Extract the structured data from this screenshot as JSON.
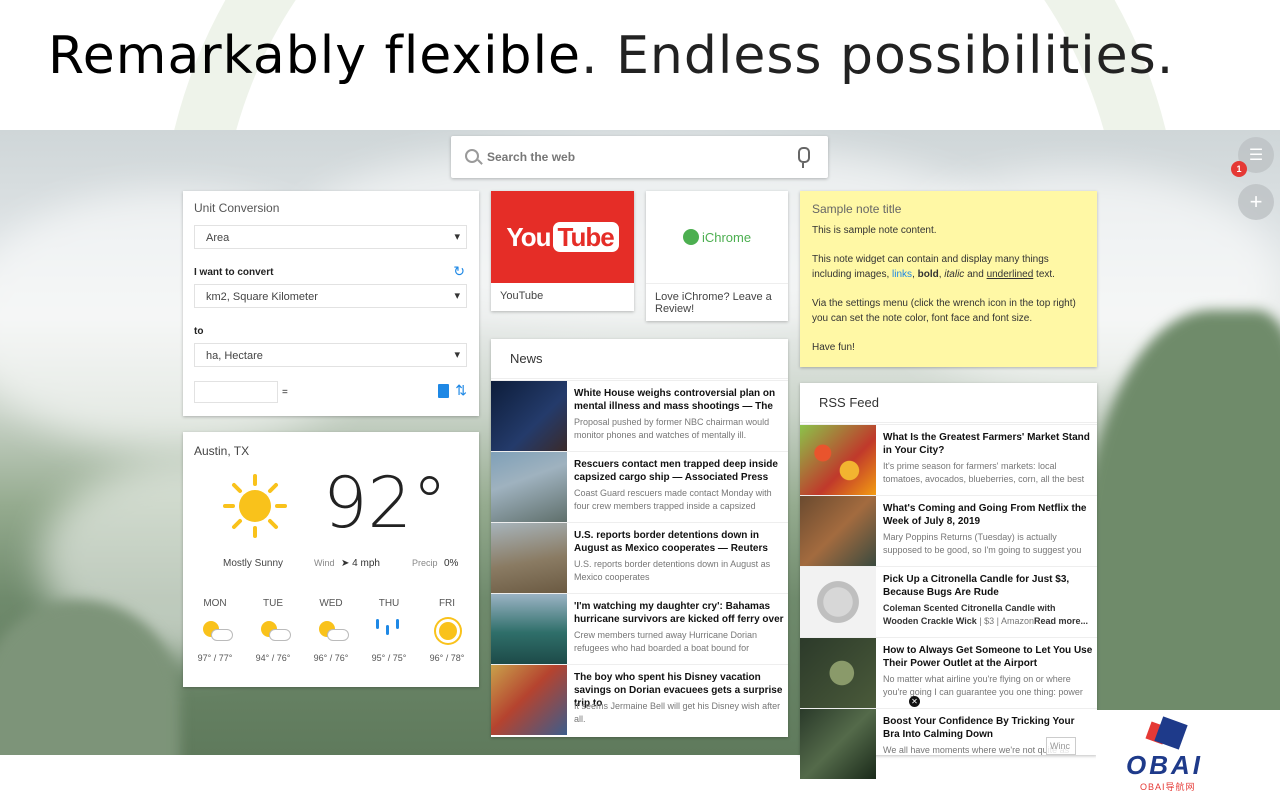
{
  "headline": {
    "bold_part": "Remarkably flexible",
    "rest": ". Endless possibilities."
  },
  "search": {
    "placeholder": "Search the web"
  },
  "side_buttons": {
    "menu_badge": "1"
  },
  "unit_conversion": {
    "title": "Unit Conversion",
    "category": "Area",
    "convert_label": "I want to convert",
    "from": "km2, Square Kilometer",
    "to_label": "to",
    "to": "ha, Hectare",
    "equals": "="
  },
  "weather": {
    "location": "Austin, TX",
    "temperature": "92°",
    "condition": "Mostly Sunny",
    "wind_label": "Wind",
    "wind_value": "4 mph",
    "precip_label": "Precip",
    "precip_value": "0%",
    "forecast": [
      {
        "day": "MON",
        "temps": "97° / 77°",
        "icon": "partly-sunny-icon"
      },
      {
        "day": "TUE",
        "temps": "94° / 76°",
        "icon": "partly-sunny-icon"
      },
      {
        "day": "WED",
        "temps": "96° / 76°",
        "icon": "partly-sunny-icon"
      },
      {
        "day": "THU",
        "temps": "95° / 75°",
        "icon": "rain-icon"
      },
      {
        "day": "FRI",
        "temps": "96° / 78°",
        "icon": "sunny-icon"
      }
    ]
  },
  "shortcuts": {
    "youtube": {
      "logo_you": "You",
      "logo_tube": "Tube",
      "caption": "YouTube"
    },
    "ichrome": {
      "logo": "iChrome",
      "caption": "Love iChrome? Leave a Review!"
    }
  },
  "news": {
    "title": "News",
    "items": [
      {
        "headline": "White House weighs controversial plan on mental illness and mass shootings — The",
        "desc": "Proposal pushed by former NBC chairman would monitor phones and watches of mentally ill."
      },
      {
        "headline": "Rescuers contact men trapped deep inside capsized cargo ship — Associated Press",
        "desc": "Coast Guard rescuers made contact Monday with four crew members trapped inside a capsized"
      },
      {
        "headline": "U.S. reports border detentions down in August as Mexico cooperates — Reuters",
        "desc": "U.S. reports border detentions down in August as Mexico cooperates"
      },
      {
        "headline": "'I'm watching my daughter cry': Bahamas hurricane survivors are kicked off ferry over",
        "desc": "Crew members turned away Hurricane Dorian refugees who had boarded a boat bound for"
      },
      {
        "headline": "The boy who spent his Disney vacation savings on Dorian evacuees gets a surprise trip to",
        "desc": "It seems Jermaine Bell will get his Disney wish after all."
      }
    ]
  },
  "note": {
    "title": "Sample note title",
    "line1": "This is sample note content.",
    "line2_a": "This note widget can contain and display many things including images, ",
    "line2_link": "links",
    "line2_b": ", ",
    "line2_bold": "bold",
    "line2_c": ", ",
    "line2_italic": "italic",
    "line2_d": " and ",
    "line2_underline": "underlined",
    "line2_e": " text.",
    "line3": "Via the settings menu (click the wrench icon in the top right) you can set the note color, font face and font size.",
    "line4": "Have fun!"
  },
  "rss": {
    "title": "RSS Feed",
    "items": [
      {
        "headline": "What Is the Greatest Farmers' Market Stand in Your City?",
        "desc": "It's prime season for farmers' markets: local tomatoes, avocados, blueberries, corn, all the best"
      },
      {
        "headline": "What's Coming and Going From Netflix the Week of July 8, 2019",
        "desc": "Mary Poppins Returns (Tuesday) is actually supposed to be good, so I'm going to suggest you"
      },
      {
        "headline": "Pick Up a Citronella Candle for Just $3, Because Bugs Are Rude",
        "desc_bold": "Coleman Scented Citronella Candle with Wooden Crackle Wick",
        "desc": " | $3 | Amazon",
        "more": "Read more..."
      },
      {
        "headline": "How to Always Get Someone to Let You Use Their Power Outlet at the Airport",
        "desc": "No matter what airline you're flying on or where you're going I can guarantee you one thing: power"
      },
      {
        "headline": "Boost Your Confidence By Tricking Your Bra Into Calming Down",
        "desc": "We all have moments where we're not quite as"
      }
    ]
  },
  "watermark": {
    "brand": "OBAI",
    "sub": "OBAI导航网",
    "win": "Winc"
  },
  "colors": {
    "accent": "#1e88e5",
    "note_bg": "#fff8a5",
    "youtube_red": "#e52d27",
    "badge": "#e53935"
  }
}
